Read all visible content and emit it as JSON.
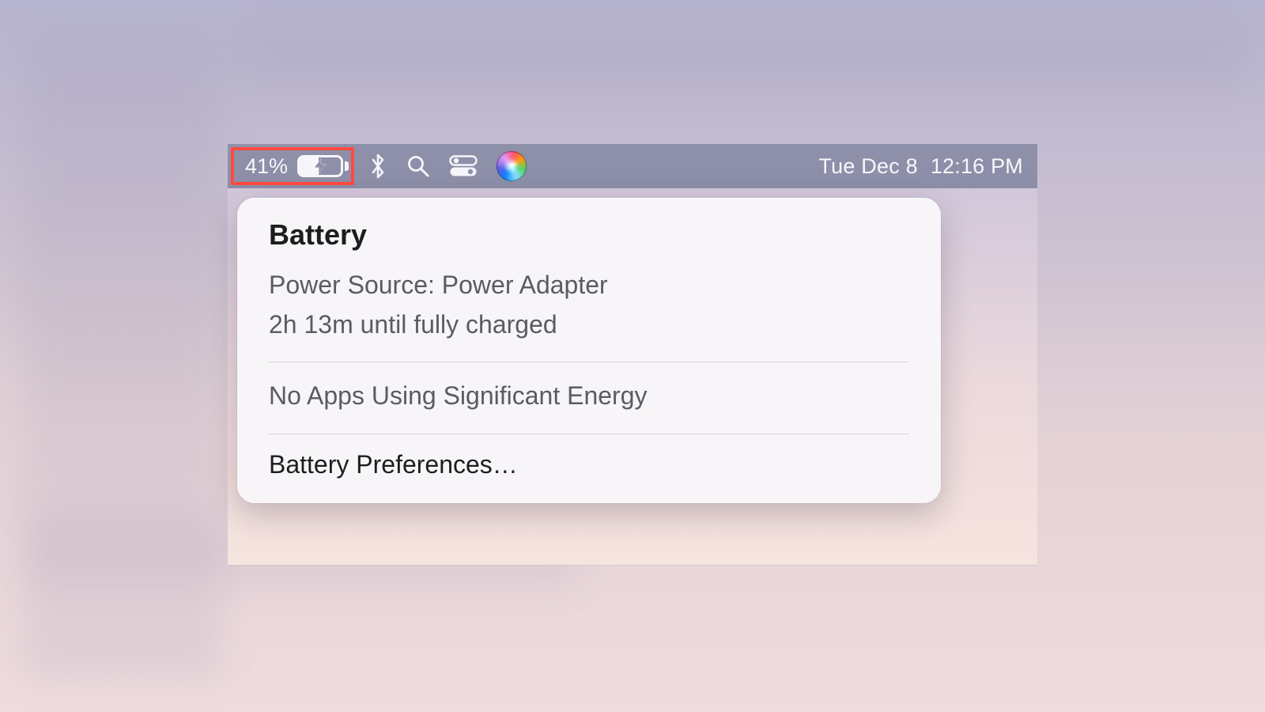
{
  "menubar": {
    "battery_percent": "41%",
    "battery_fill_percent": 41,
    "date": "Tue Dec 8",
    "time": "12:16 PM",
    "icons": {
      "bluetooth": "bluetooth-icon",
      "search": "search-icon",
      "control_center": "control-center-icon",
      "siri": "siri-icon"
    }
  },
  "popover": {
    "title": "Battery",
    "power_source_line": "Power Source: Power Adapter",
    "time_remaining_line": "2h 13m until fully charged",
    "apps_energy_line": "No Apps Using Significant Energy",
    "preferences_label": "Battery Preferences…"
  },
  "highlight": {
    "color": "#ff4a3f"
  }
}
